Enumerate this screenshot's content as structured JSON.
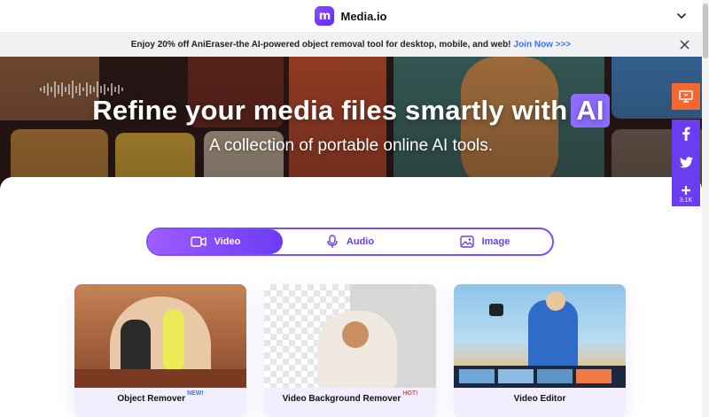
{
  "header": {
    "logo_letter": "m",
    "brand": "Media.io",
    "menu_icon": "chevron-down-icon"
  },
  "promo": {
    "text": "Enjoy 20% off AniEraser-the AI-powered object removal tool for desktop, mobile, and web!",
    "link": "Join Now >>>",
    "close_icon": "close-icon"
  },
  "hero": {
    "title": "Refine your media files smartly with",
    "title_badge": "AI",
    "subtitle": "A collection of portable online AI tools."
  },
  "tabs": [
    {
      "label": "Video",
      "icon": "video-camera-icon",
      "active": true
    },
    {
      "label": "Audio",
      "icon": "microphone-icon",
      "active": false
    },
    {
      "label": "Image",
      "icon": "image-icon",
      "active": false
    }
  ],
  "cards": [
    {
      "label": "Object Remover",
      "tag": "NEW!"
    },
    {
      "label": "Video Background Remover",
      "tag": "HOT!"
    },
    {
      "label": "Video Editor",
      "tag": ""
    }
  ],
  "side": {
    "share_count": "3.1K"
  },
  "colors": {
    "accent": "#6a3df0",
    "accent_light": "#a05cff",
    "promo_link": "#3b76f6",
    "hot": "#ff4b3a",
    "side_orange": "#f4672f"
  }
}
